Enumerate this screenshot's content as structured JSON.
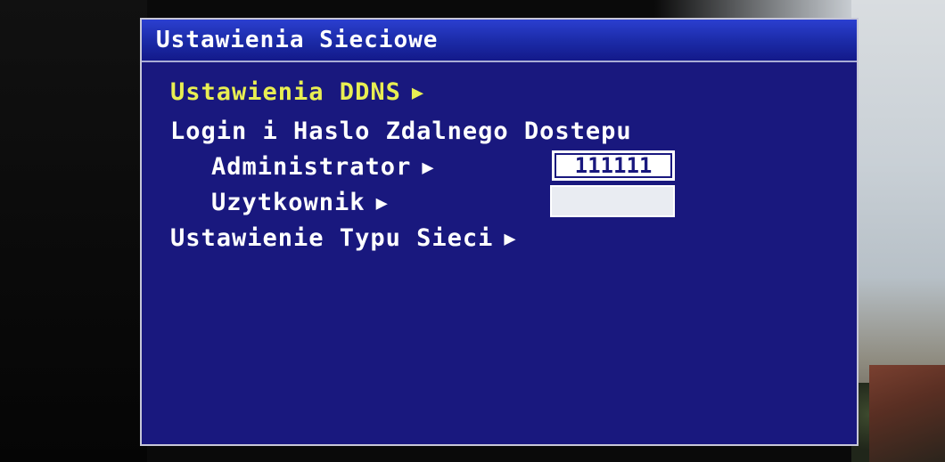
{
  "osd": {
    "title": "Ustawienia Sieciowe",
    "items": [
      {
        "label": "Ustawienia DDNS",
        "arrow": "▶",
        "selected": true
      },
      {
        "label": "Login i Haslo Zdalnego Dostepu"
      },
      {
        "label": "Administrator",
        "arrow": "▶",
        "value": "111111"
      },
      {
        "label": "Uzytkownik",
        "arrow": "▶",
        "value": ""
      },
      {
        "label": "Ustawienie Typu Sieci",
        "arrow": "▶"
      }
    ]
  },
  "colors": {
    "panel_bg": "#19187e",
    "title_bar": "#2b3fd0",
    "text": "#ffffff",
    "selected_text": "#e8ee52"
  }
}
